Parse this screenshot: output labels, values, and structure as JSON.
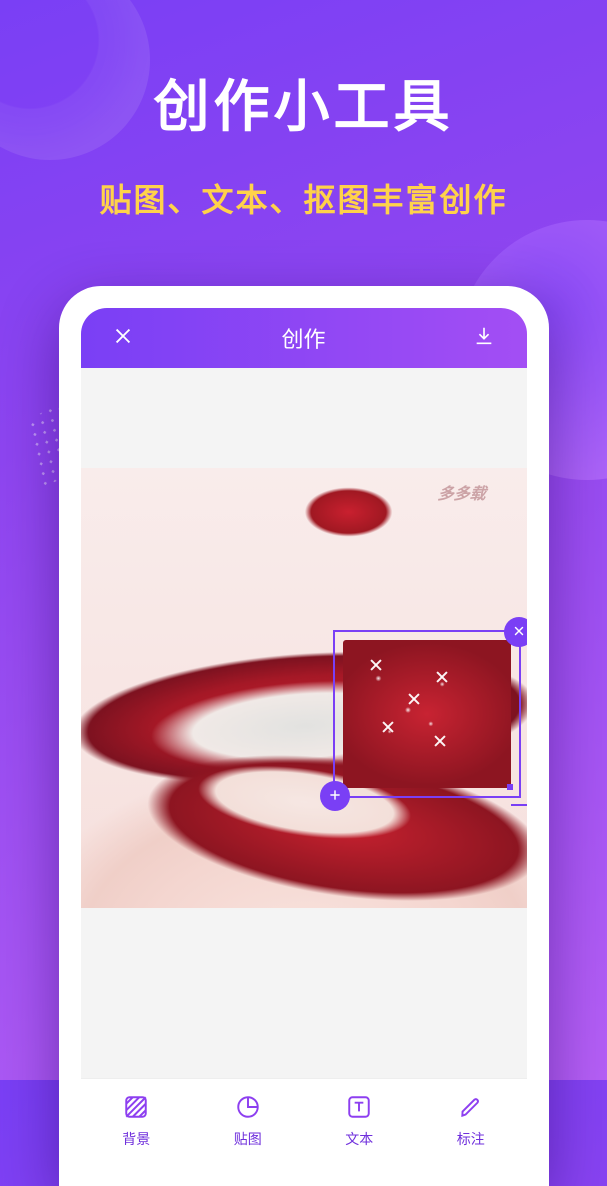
{
  "promo": {
    "headline": "创作小工具",
    "subhead": "贴图、文本、抠图丰富创作"
  },
  "editor": {
    "header_title": "创作",
    "watermark": "多多载"
  },
  "selection": {
    "close_label": "delete-sticker",
    "add_label": "duplicate-sticker",
    "resize_label": "resize-handle"
  },
  "toolbar": {
    "items": [
      {
        "icon": "hatch-square-icon",
        "label": "背景"
      },
      {
        "icon": "circle-slice-icon",
        "label": "贴图"
      },
      {
        "icon": "text-square-icon",
        "label": "文本"
      },
      {
        "icon": "pencil-icon",
        "label": "标注"
      }
    ]
  },
  "colors": {
    "accent": "#7a3ff5",
    "accent2": "#a34ef4",
    "highlight": "#ffd24a"
  }
}
